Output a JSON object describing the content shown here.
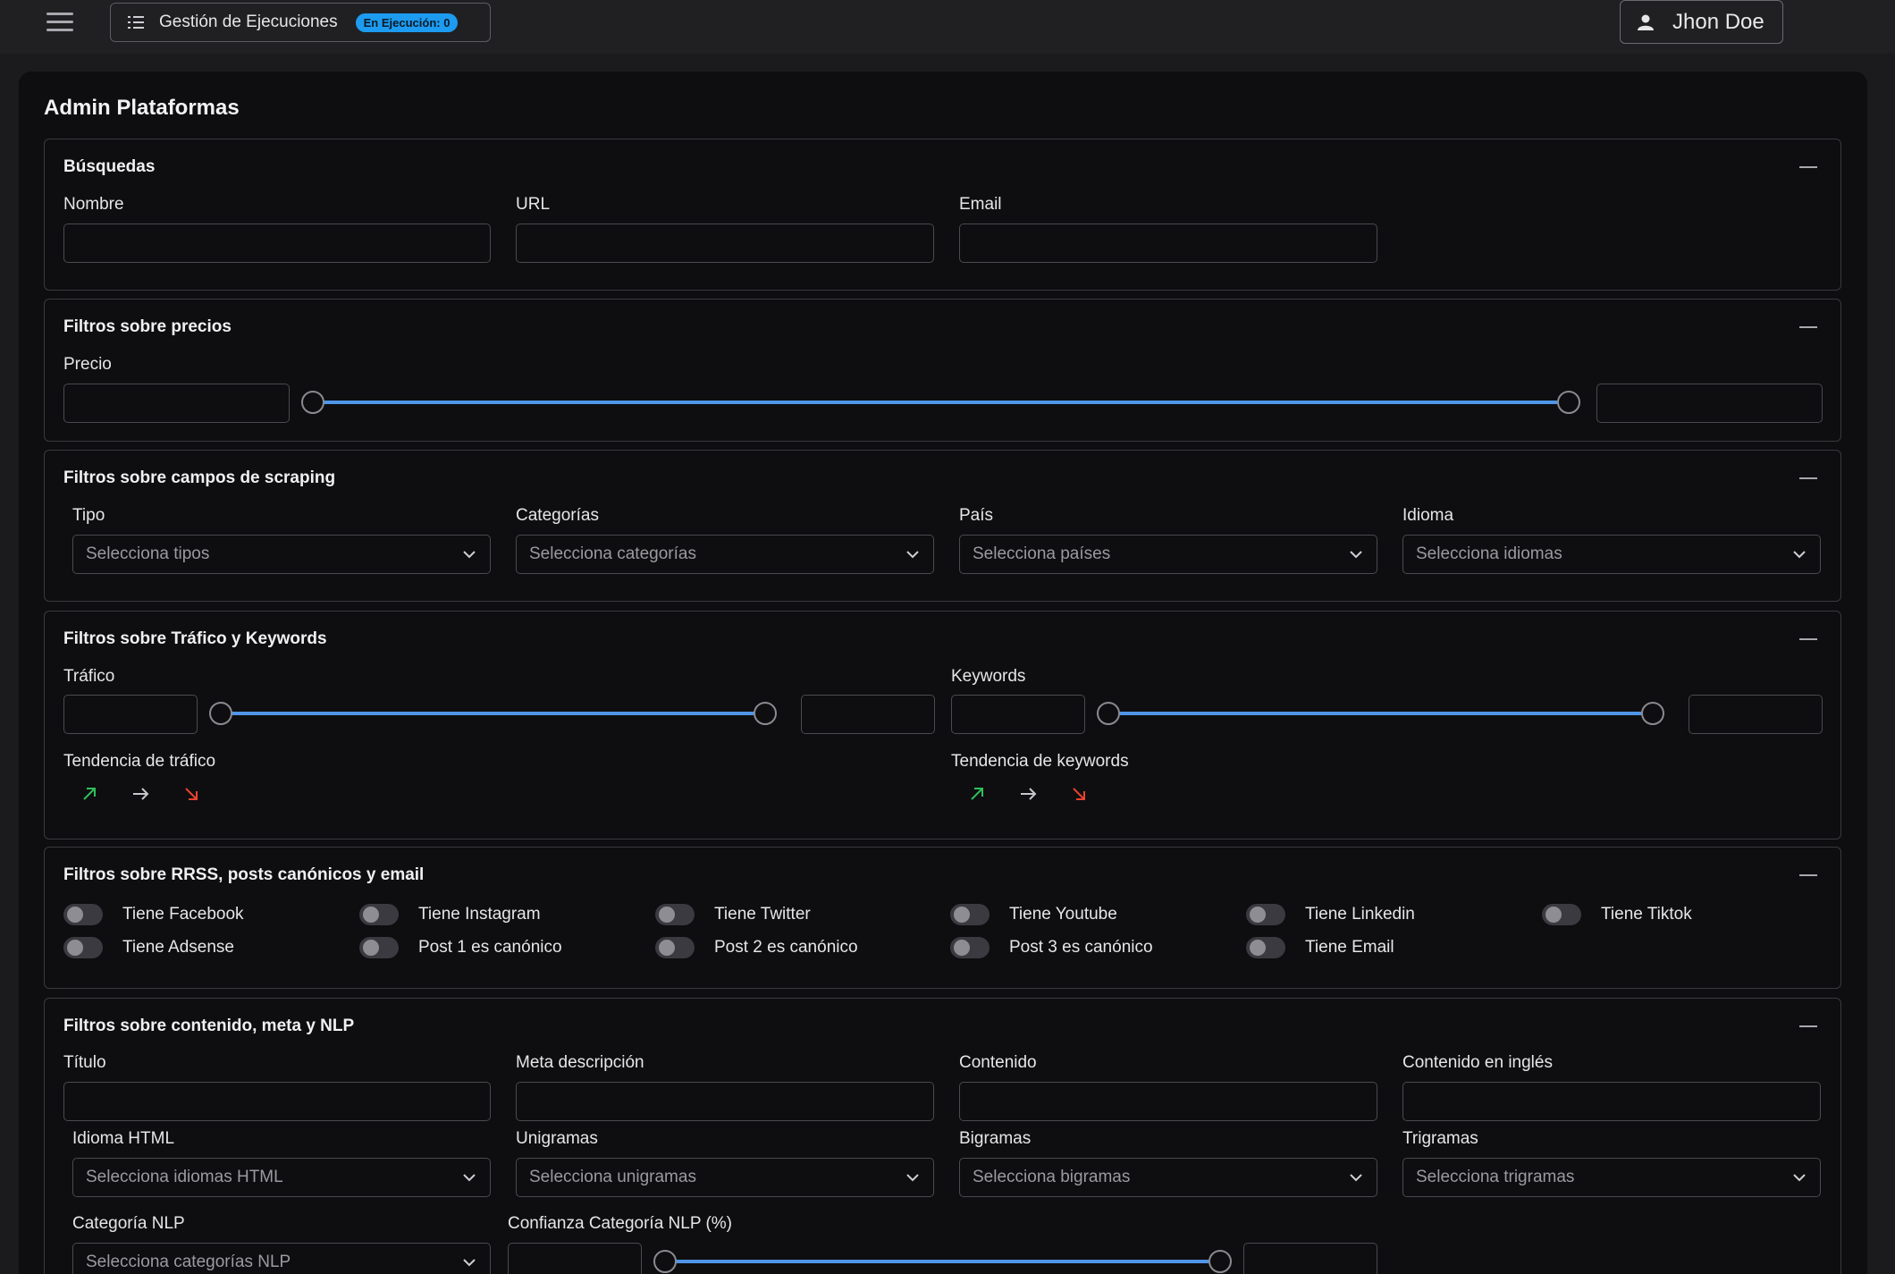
{
  "header": {
    "executions_label": "Gestión de Ejecuciones",
    "executions_badge": "En Ejecución: 0",
    "user_name": "Jhon Doe"
  },
  "page_title": "Admin Plataformas",
  "busquedas": {
    "title": "Búsquedas",
    "nombre_label": "Nombre",
    "url_label": "URL",
    "email_label": "Email"
  },
  "precios": {
    "title": "Filtros sobre precios",
    "precio_label": "Precio"
  },
  "scraping": {
    "title": "Filtros sobre campos de scraping",
    "tipo_label": "Tipo",
    "tipo_placeholder": "Selecciona tipos",
    "categorias_label": "Categorías",
    "categorias_placeholder": "Selecciona categorías",
    "pais_label": "País",
    "pais_placeholder": "Selecciona países",
    "idioma_label": "Idioma",
    "idioma_placeholder": "Selecciona idiomas"
  },
  "trafico": {
    "title": "Filtros sobre Tráfico y Keywords",
    "trafico_label": "Tráfico",
    "keywords_label": "Keywords",
    "tendencia_trafico_label": "Tendencia de tráfico",
    "tendencia_keywords_label": "Tendencia de keywords",
    "trend_icons": [
      "arrow-up-right-icon",
      "arrow-right-icon",
      "arrow-down-right-icon"
    ],
    "trend_colors": {
      "up": "#2fbf5a",
      "flat": "#c8c8cc",
      "down": "#e8442e"
    }
  },
  "rrss": {
    "title": "Filtros sobre RRSS, posts canónicos y email",
    "toggles": [
      "Tiene Facebook",
      "Tiene Instagram",
      "Tiene Twitter",
      "Tiene Youtube",
      "Tiene Linkedin",
      "Tiene Tiktok",
      "Tiene Adsense",
      "Post 1 es canónico",
      "Post 2 es canónico",
      "Post 3 es canónico",
      "Tiene Email"
    ]
  },
  "contenido": {
    "title": "Filtros sobre contenido, meta y NLP",
    "titulo_label": "Título",
    "meta_label": "Meta descripción",
    "contenido_label": "Contenido",
    "contenido_en_label": "Contenido en inglés",
    "idioma_html_label": "Idioma HTML",
    "idioma_html_placeholder": "Selecciona idiomas HTML",
    "unigramas_label": "Unigramas",
    "unigramas_placeholder": "Selecciona unigramas",
    "bigramas_label": "Bigramas",
    "bigramas_placeholder": "Selecciona bigramas",
    "trigramas_label": "Trigramas",
    "trigramas_placeholder": "Selecciona trigramas",
    "categoria_nlp_label": "Categoría NLP",
    "categoria_nlp_placeholder": "Selecciona categorías NLP",
    "confianza_label": "Confianza Categoría NLP (%)"
  },
  "colors": {
    "accent": "#4f95e8",
    "badge": "#1d9bf0",
    "background": "#0e0e10"
  }
}
